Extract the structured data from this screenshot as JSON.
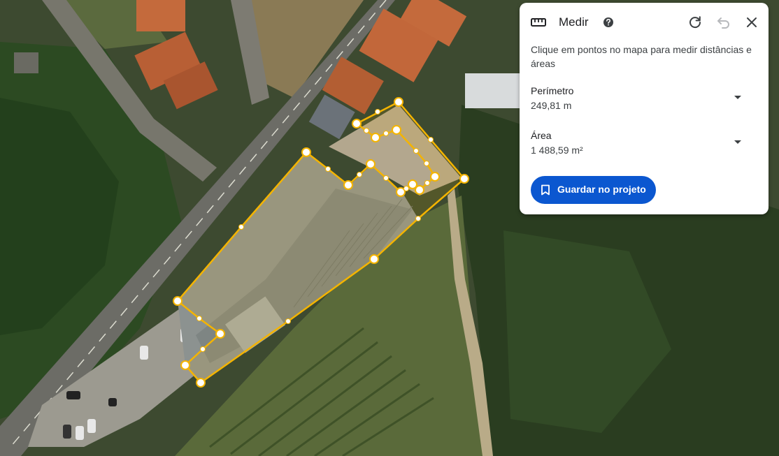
{
  "panel": {
    "title": "Medir",
    "description": "Clique em pontos no mapa para medir distâncias e áreas",
    "perimeter_label": "Perímetro",
    "perimeter_value": "249,81 m",
    "area_label": "Área",
    "area_value": "1 488,59 m²",
    "save_button_label": "Guardar no projeto",
    "icons": [
      "ruler-icon",
      "help-icon",
      "reset-icon",
      "undo-icon",
      "close-icon",
      "caret-down-icon",
      "bookmark-icon"
    ],
    "accent_color": "#0b57d0"
  },
  "map": {
    "measure_line_color": "#f4b400"
  }
}
